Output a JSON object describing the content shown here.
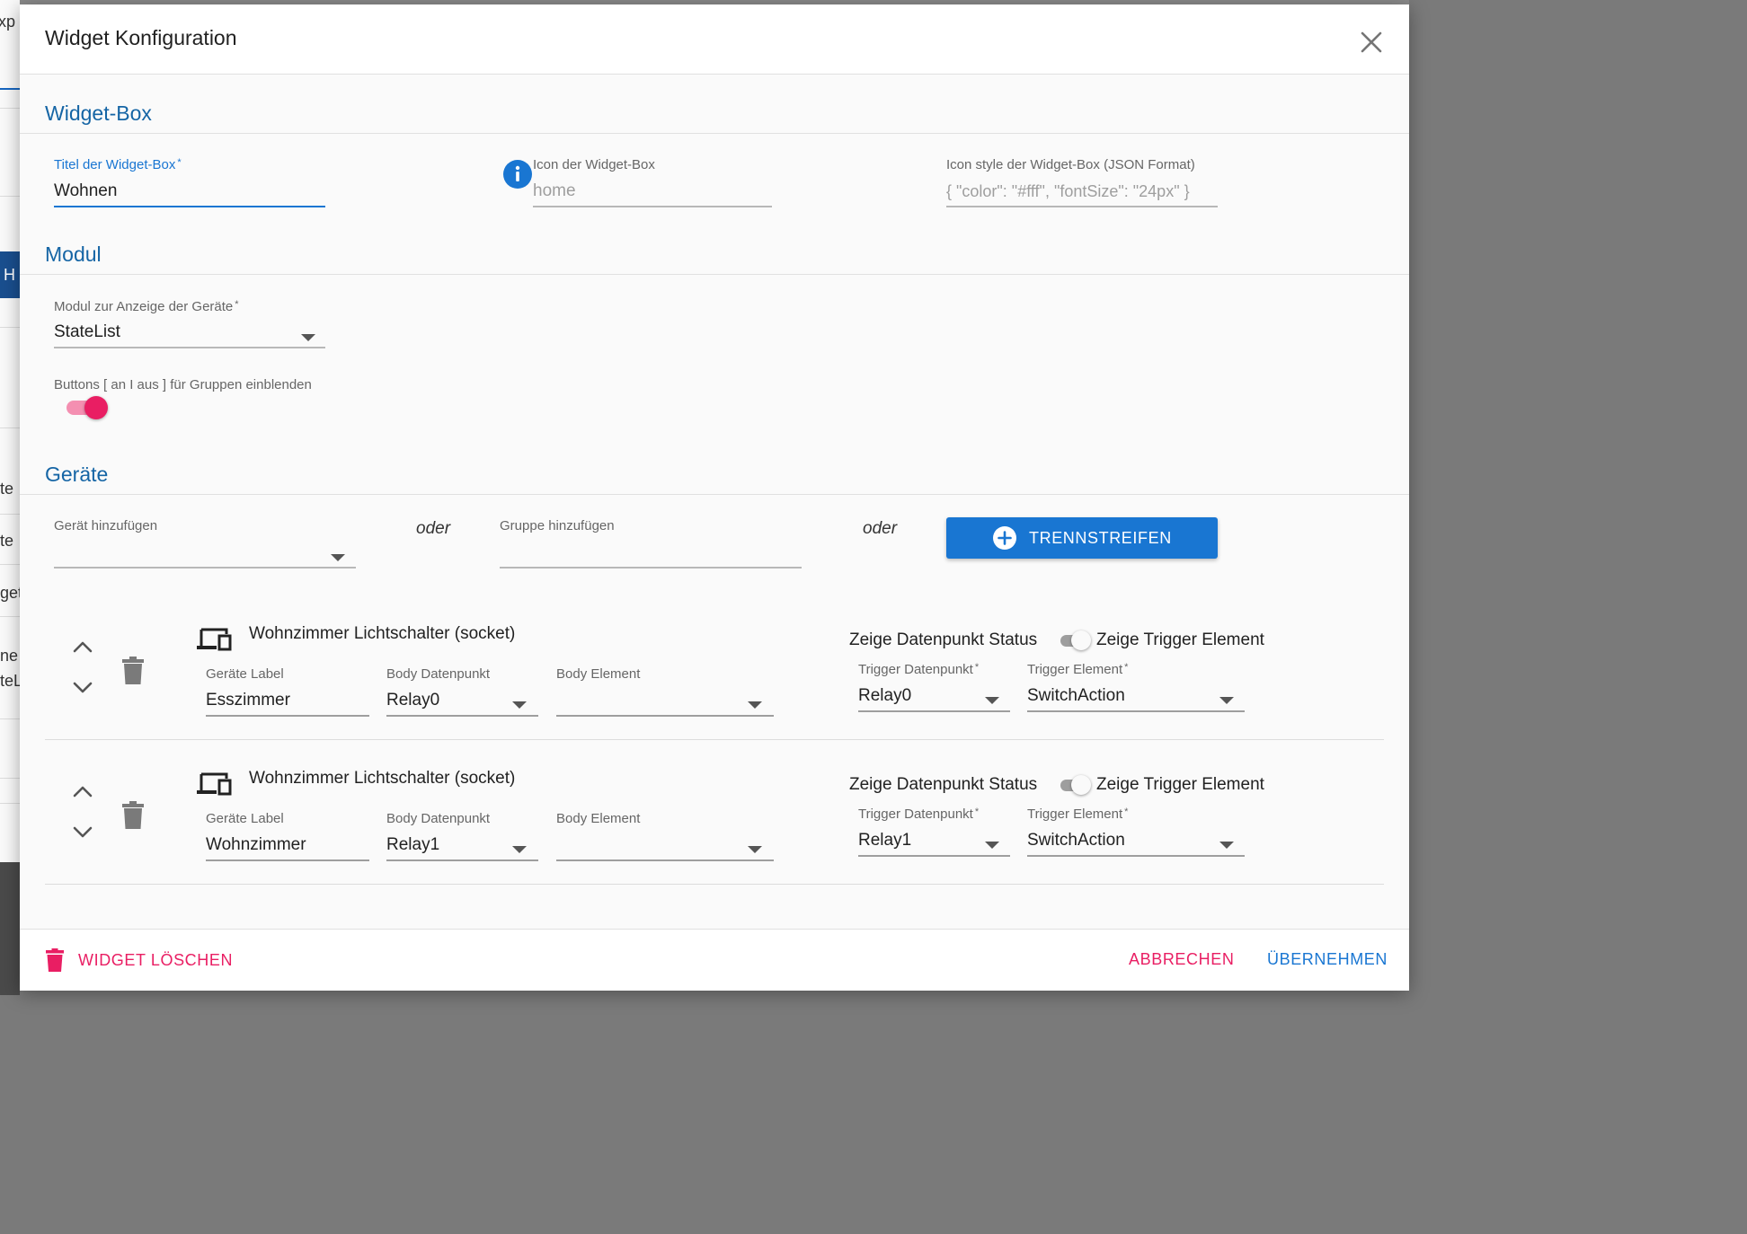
{
  "background_fragments": [
    "xp",
    "H",
    "te",
    "te",
    "get",
    "ne",
    "teL"
  ],
  "dialog": {
    "title": "Widget Konfiguration",
    "close_icon": "close-icon"
  },
  "widget_box": {
    "section_title": "Widget-Box",
    "title_field": {
      "label": "Titel der Widget-Box",
      "required_mark": "*",
      "value": "Wohnen"
    },
    "icon_field": {
      "label": "Icon der Widget-Box",
      "placeholder": "home",
      "value": ""
    },
    "icon_style_field": {
      "label": "Icon style der Widget-Box (JSON Format)",
      "placeholder": "{ \"color\": \"#fff\", \"fontSize\": \"24px\" }",
      "value": ""
    }
  },
  "modul": {
    "section_title": "Modul",
    "module_select": {
      "label": "Modul zur Anzeige der Geräte",
      "required_mark": "*",
      "value": "StateList"
    },
    "group_buttons_switch": {
      "label": "Buttons [ an I aus ] für Gruppen einblenden",
      "checked": true
    }
  },
  "geraete": {
    "section_title": "Geräte",
    "add_device": {
      "label": "Gerät hinzufügen",
      "value": ""
    },
    "separator_word": "oder",
    "add_group": {
      "label": "Gruppe hinzufügen",
      "value": ""
    },
    "separator_button": "TRENNSTREIFEN",
    "devices": [
      {
        "name": "Wohnzimmer Lichtschalter (socket)",
        "label_field": {
          "label": "Geräte Label",
          "value": "Esszimmer"
        },
        "body_dp": {
          "label": "Body Datenpunkt",
          "value": "Relay0"
        },
        "body_element": {
          "label": "Body Element",
          "value": ""
        },
        "toggle": {
          "left": "Zeige Datenpunkt Status",
          "right": "Zeige Trigger Element"
        },
        "trigger_dp": {
          "label": "Trigger Datenpunkt",
          "required_mark": "*",
          "value": "Relay0"
        },
        "trigger_element": {
          "label": "Trigger Element",
          "required_mark": "*",
          "value": "SwitchAction"
        }
      },
      {
        "name": "Wohnzimmer Lichtschalter (socket)",
        "label_field": {
          "label": "Geräte Label",
          "value": "Wohnzimmer"
        },
        "body_dp": {
          "label": "Body Datenpunkt",
          "value": "Relay1"
        },
        "body_element": {
          "label": "Body Element",
          "value": ""
        },
        "toggle": {
          "left": "Zeige Datenpunkt Status",
          "right": "Zeige Trigger Element"
        },
        "trigger_dp": {
          "label": "Trigger Datenpunkt",
          "required_mark": "*",
          "value": "Relay1"
        },
        "trigger_element": {
          "label": "Trigger Element",
          "required_mark": "*",
          "value": "SwitchAction"
        }
      }
    ]
  },
  "footer": {
    "delete_label": "WIDGET LÖSCHEN",
    "cancel_label": "ABBRECHEN",
    "apply_label": "ÜBERNEHMEN"
  },
  "colors": {
    "section_title": "#1565a5",
    "focus_blue": "#1976d2",
    "accent_pink": "#e91e63",
    "dialog_bg": "#fafafa"
  }
}
